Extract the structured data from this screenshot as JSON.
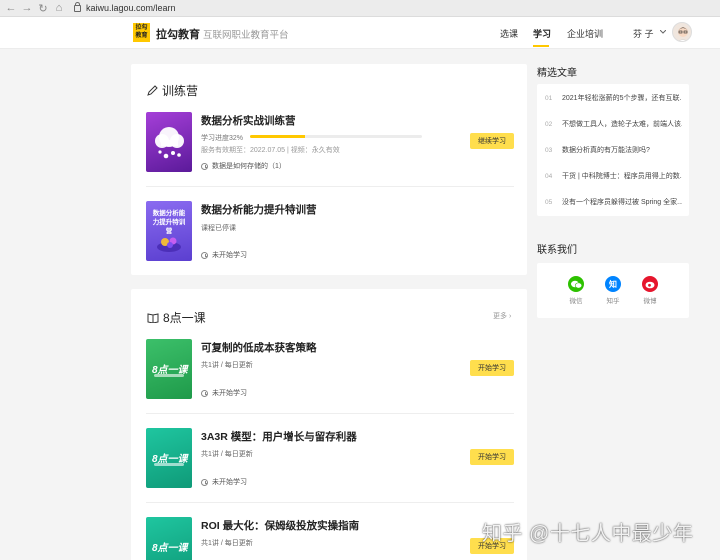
{
  "browser": {
    "url": "kaiwu.lagou.com/learn"
  },
  "header": {
    "logo_text_top": "拉勾",
    "logo_text_bottom": "教育",
    "brand": "拉勾教育",
    "subtitle": "互联网职业教育平台",
    "nav": [
      "选课",
      "学习",
      "企业培训"
    ],
    "active_nav": "学习",
    "user_name": "芬 子",
    "accent": "#ffc800"
  },
  "bootcamp": {
    "title": "训练营",
    "courses": [
      {
        "title": "数据分析实战训练营",
        "progress_label": "学习进度32%",
        "progress": 0.32,
        "validity": "服务有效期至：2022.07.05 | 视频：永久有效",
        "status": "数据是如何存储的（1）",
        "button": "继续学习"
      },
      {
        "title": "数据分析能力提升特训营",
        "thumb_text": "数据分析能力提升特训营",
        "meta": "课程已停课",
        "status": "未开始学习"
      }
    ]
  },
  "eight_oclock": {
    "title": "8点一课",
    "more": "更多",
    "thumb_text": "8点一课",
    "courses": [
      {
        "title": "可复制的低成本获客策略",
        "meta": "共1讲 / 每日更新",
        "status": "未开始学习",
        "button": "开始学习"
      },
      {
        "title": "3A3R 模型：用户增长与留存利器",
        "meta": "共1讲 / 每日更新",
        "status": "未开始学习",
        "button": "开始学习"
      },
      {
        "title": "ROI 最大化：保姆级投放实操指南",
        "meta": "共1讲 / 每日更新",
        "button": "开始学习"
      }
    ]
  },
  "sidebar": {
    "articles_title": "精选文章",
    "articles": [
      {
        "num": "01",
        "text": "2021年轻松涨薪的5个步骤，还有互联..."
      },
      {
        "num": "02",
        "text": "不想做工具人，造轮子太难，前端人该..."
      },
      {
        "num": "03",
        "text": "数据分析真的有万能法则吗?"
      },
      {
        "num": "04",
        "text": "干货 | 中科院博士：程序员用得上的数..."
      },
      {
        "num": "05",
        "text": "没有一个程序员躲得过被 Spring 全家..."
      }
    ],
    "contact_title": "联系我们",
    "contacts": [
      {
        "label": "微信",
        "icon": "wechat-icon",
        "color": "#2dc100"
      },
      {
        "label": "知乎",
        "icon": "zhihu-icon",
        "color": "#0084ff",
        "glyph": "知"
      },
      {
        "label": "微博",
        "icon": "weibo-icon",
        "color": "#e6162d"
      }
    ]
  },
  "watermark": "知乎 @十七人中最少年"
}
